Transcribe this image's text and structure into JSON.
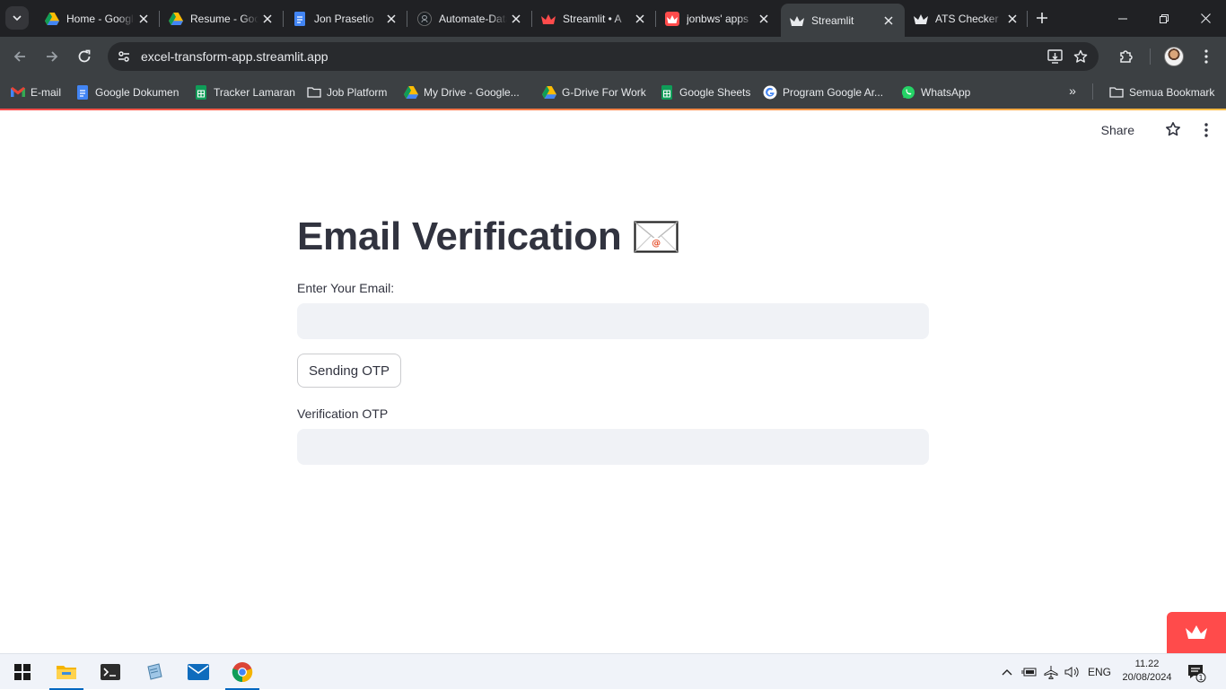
{
  "browser": {
    "tabs": [
      {
        "title": "Home - Google Drive",
        "favicon": "google-drive-icon",
        "active": false
      },
      {
        "title": "Resume - Google Drive",
        "favicon": "google-drive-icon",
        "active": false
      },
      {
        "title": "Jon Prasetio",
        "favicon": "google-docs-icon",
        "active": false
      },
      {
        "title": "Automate-Data",
        "favicon": "github-icon",
        "active": false
      },
      {
        "title": "Streamlit • A",
        "favicon": "streamlit-icon",
        "active": false
      },
      {
        "title": "jonbws' apps",
        "favicon": "streamlit-icon",
        "active": false
      },
      {
        "title": "Streamlit",
        "favicon": "streamlit-dark-icon",
        "active": true
      },
      {
        "title": "ATS Checker",
        "favicon": "streamlit-dark-icon",
        "active": false
      }
    ],
    "url": "excel-transform-app.streamlit.app",
    "bookmarks": [
      {
        "label": "E-mail",
        "icon": "gmail-icon"
      },
      {
        "label": "Google Dokumen",
        "icon": "google-docs-icon"
      },
      {
        "label": "Tracker Lamaran",
        "icon": "google-sheets-icon"
      },
      {
        "label": "Job Platform",
        "icon": "folder-icon"
      },
      {
        "label": "My Drive - Google...",
        "icon": "google-drive-icon"
      },
      {
        "label": "G-Drive For Work",
        "icon": "google-drive-icon"
      },
      {
        "label": "Google Sheets",
        "icon": "google-sheets-icon"
      },
      {
        "label": "Program Google Ar...",
        "icon": "google-icon"
      },
      {
        "label": "WhatsApp",
        "icon": "whatsapp-icon"
      }
    ],
    "all_bookmarks_label": "Semua Bookmark"
  },
  "app": {
    "header": {
      "share_label": "Share"
    },
    "title": "Email Verification",
    "title_emoji": "envelope-icon",
    "email_label": "Enter Your Email:",
    "email_value": "",
    "send_button_label": "Sending OTP",
    "otp_label": "Verification OTP",
    "otp_value": ""
  },
  "taskbar": {
    "apps": [
      "windows-start-icon",
      "file-explorer-icon",
      "terminal-icon",
      "notepad-icon",
      "mail-icon",
      "chrome-icon"
    ],
    "language": "ENG",
    "time": "11.22",
    "date": "20/08/2024",
    "notification_count": "1"
  },
  "colors": {
    "streamlit_red": "#ff4b4b",
    "input_bg": "#f0f2f6",
    "text": "#31333f",
    "chrome_dark": "#202124",
    "chrome_toolbar": "#3c4043"
  }
}
